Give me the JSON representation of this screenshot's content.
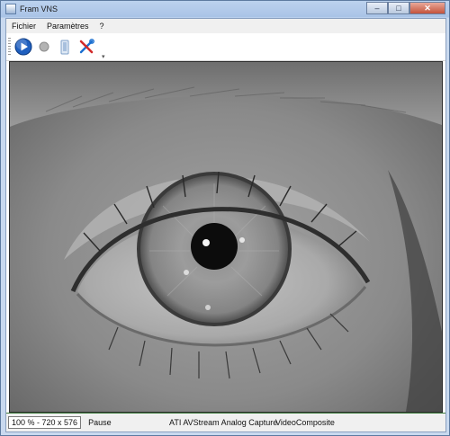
{
  "window": {
    "title": "Fram VNS",
    "controls": {
      "minimize": "–",
      "maximize": "□",
      "close": "✕"
    }
  },
  "menubar": {
    "items": [
      "Fichier",
      "Paramètres",
      "?"
    ]
  },
  "toolbar": {
    "buttons": [
      {
        "icon": "play-icon",
        "color": "#1f5fbf"
      },
      {
        "icon": "stop-icon",
        "color": "#b3b3b3"
      },
      {
        "icon": "snapshot-icon",
        "color": "#7fa0c8"
      },
      {
        "icon": "tools-icon",
        "color": "#d22b2b"
      }
    ]
  },
  "video": {
    "content": "eye-close-up"
  },
  "statusbar": {
    "zoom": "100 % - 720 x 576",
    "state": "Pause",
    "device": "ATI AVStream Analog Capture",
    "input": "VideoComposite"
  }
}
